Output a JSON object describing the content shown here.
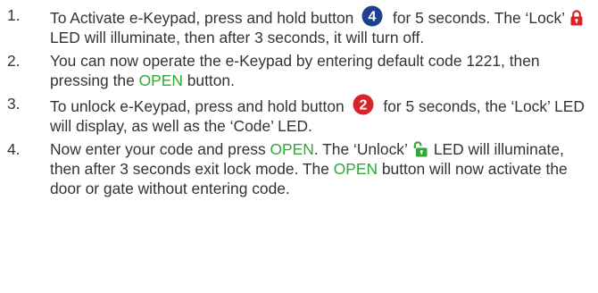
{
  "steps": [
    {
      "number": "1.",
      "parts": [
        "To Activate e-Keypad, press and hold button",
        "4",
        "for 5 seconds. The ‘Lock’",
        "LED will illuminate, then after 3 seconds, it will turn off."
      ]
    },
    {
      "number": "2.",
      "parts": [
        "You can now operate the e-Keypad by entering default code 1221, then pressing the",
        "OPEN",
        "button."
      ]
    },
    {
      "number": "3.",
      "parts": [
        "To unlock e-Keypad, press and hold button",
        "2",
        "for 5 seconds, the ‘Lock’ LED will display, as well as the ‘Code’ LED."
      ]
    },
    {
      "number": "4.",
      "parts": [
        "Now enter your code and press",
        "OPEN",
        ". The ‘Unlock’",
        "LED will illuminate, then after 3 seconds exit lock mode. The",
        "OPEN",
        "button will now activate the door or gate without entering code."
      ]
    }
  ],
  "colors": {
    "text": "#333333",
    "accent_green": "#2ea836",
    "button4_badge": "#1f3f8f",
    "button2_badge": "#d8232a",
    "lock_red": "#d8232a",
    "unlock_green": "#2ea836"
  },
  "icons": {
    "button4": "number-4-circle-icon",
    "button2": "number-2-circle-icon",
    "lock": "padlock-closed-icon",
    "unlock": "padlock-open-icon"
  }
}
